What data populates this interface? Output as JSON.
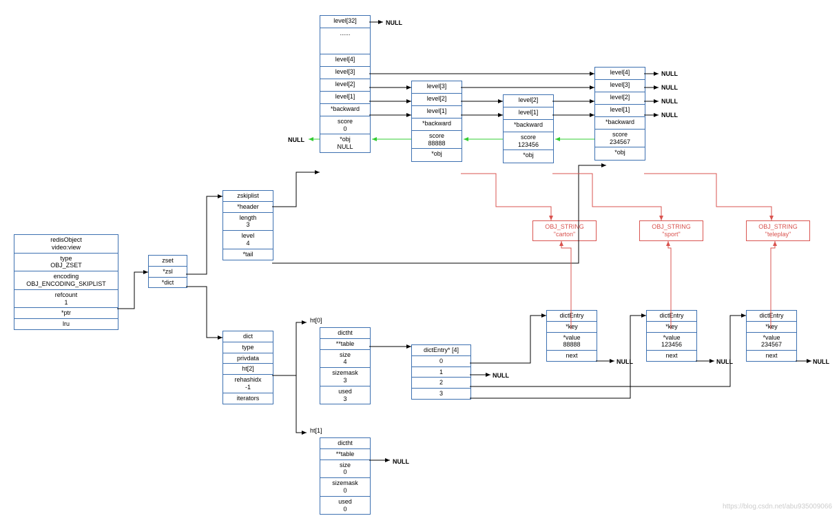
{
  "redisObject": {
    "title": "redisObject\nvideo:view",
    "type": "type\nOBJ_ZSET",
    "encoding": "encoding\nOBJ_ENCODING_SKIPLIST",
    "refcount": "refcount\n1",
    "ptr": "*ptr",
    "lru": "lru"
  },
  "zset": {
    "header": "zset",
    "zsl": "*zsl",
    "dict": "*dict"
  },
  "zskiplist": {
    "title": "zskiplist",
    "header": "*header",
    "length": "length\n3",
    "level": "level\n4",
    "tail": "*tail"
  },
  "hdr": {
    "l32": "level[32]",
    "dots": "......",
    "l4": "level[4]",
    "l3": "level[3]",
    "l2": "level[2]",
    "l1": "level[1]",
    "back": "*backward",
    "score": "score\n0",
    "obj": "*obj\nNULL"
  },
  "n1": {
    "l3": "level[3]",
    "l2": "level[2]",
    "l1": "level[1]",
    "back": "*backward",
    "score": "score\n88888",
    "obj": "*obj"
  },
  "n2": {
    "l2": "level[2]",
    "l1": "level[1]",
    "back": "*backward",
    "score": "score\n123456",
    "obj": "*obj"
  },
  "n3": {
    "l4": "level[4]",
    "l3": "level[3]",
    "l2": "level[2]",
    "l1": "level[1]",
    "back": "*backward",
    "score": "score\n234567",
    "obj": "*obj"
  },
  "str": {
    "carton": "OBJ_STRING\n\"carton\"",
    "sport": "OBJ_STRING\n\"sport\"",
    "teleplay": "OBJ_STRING\n\"teleplay\""
  },
  "dict": {
    "title": "dict",
    "type": "type",
    "privdata": "privdata",
    "ht": "ht[2]",
    "rehashidx": "rehashidx\n-1",
    "iterators": "iterators"
  },
  "ht0": {
    "label": "ht[0]",
    "title": "dictht",
    "table": "**table",
    "size": "size\n4",
    "sizemask": "sizemask\n3",
    "used": "used\n3"
  },
  "ht1": {
    "label": "ht[1]",
    "title": "dictht",
    "table": "**table",
    "size": "size\n0",
    "sizemask": "sizemask\n0",
    "used": "used\n0"
  },
  "entryArr": {
    "title": "dictEntry* [4]",
    "e0": "0",
    "e1": "1",
    "e2": "2",
    "e3": "3"
  },
  "de": {
    "title": "dictEntry",
    "key": "*key",
    "v1": "*value\n88888",
    "v2": "*value\n123456",
    "v3": "*value\n234567",
    "next": "next"
  },
  "null": "NULL",
  "watermark": "https://blog.csdn.net/abu935009066"
}
